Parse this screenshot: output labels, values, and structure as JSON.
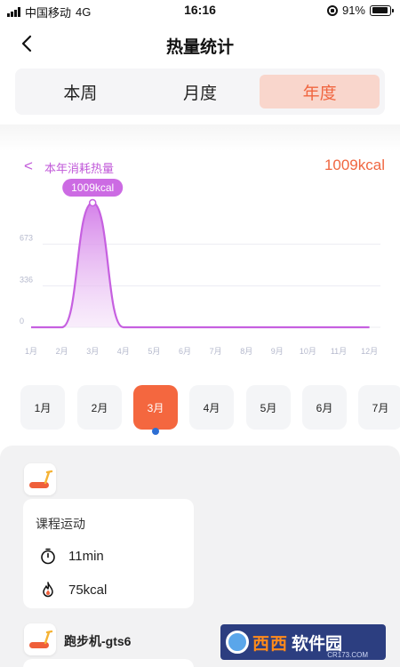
{
  "status_bar": {
    "carrier": "中国移动",
    "network": "4G",
    "time": "16:16",
    "battery": "91%",
    "battery_level": 0.91,
    "icons": [
      "signal-icon",
      "rotation-lock-icon",
      "battery-icon"
    ]
  },
  "nav": {
    "title": "热量统计",
    "back_icon": "chevron-left-icon"
  },
  "tabs": [
    {
      "label": "本周",
      "active": false
    },
    {
      "label": "月度",
      "active": false
    },
    {
      "label": "年度",
      "active": true
    }
  ],
  "chart_header": {
    "back_symbol": "<",
    "label": "本年消耗热量",
    "total": "1009kcal"
  },
  "chart_data": {
    "type": "area",
    "categories": [
      "1月",
      "2月",
      "3月",
      "4月",
      "5月",
      "6月",
      "7月",
      "8月",
      "9月",
      "10月",
      "11月",
      "12月"
    ],
    "values": [
      0,
      0,
      1009,
      0,
      0,
      0,
      0,
      0,
      0,
      0,
      0,
      0
    ],
    "yticks": [
      "0",
      "336",
      "673"
    ],
    "ylim": [
      0,
      1009
    ],
    "grid": true,
    "tooltip": {
      "category": "3月",
      "label": "1009kcal"
    },
    "colors": {
      "line": "#c660e0",
      "fill_top": "#d27ae8",
      "fill_bottom": "#f3dcf8",
      "tooltip": "#cc6be3"
    }
  },
  "months": {
    "items": [
      "1月",
      "2月",
      "3月",
      "4月",
      "5月",
      "6月",
      "7月"
    ],
    "selected": "3月"
  },
  "records": [
    {
      "device_icon": "treadmill-icon",
      "title": "课程运动",
      "duration_icon": "stopwatch-icon",
      "duration": "11min",
      "calories_icon": "flame-icon",
      "calories": "75kcal"
    },
    {
      "device_icon": "treadmill-icon",
      "name": "跑步机-gts6"
    }
  ],
  "watermark": {
    "brand_main": "西西",
    "brand_sub": "软件园",
    "url": "CR173.COM"
  },
  "colors": {
    "accent": "#f06640",
    "active_tab_bg": "#f9d6cc",
    "purple": "#c15ad9",
    "selected_month": "#f4673f",
    "indicator": "#2d6ed3"
  }
}
